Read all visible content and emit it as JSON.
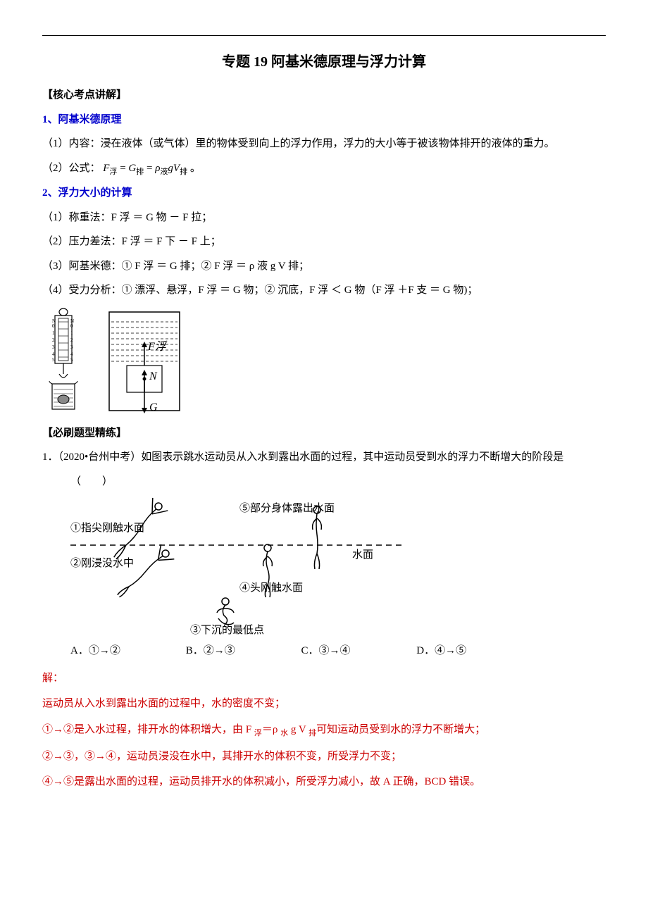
{
  "title": "专题 19 阿基米德原理与浮力计算",
  "sections": {
    "core_label": "【核心考点讲解】",
    "h1": "1、阿基米德原理",
    "p1": "（1）内容：浸在液体（或气体）里的物体受到向上的浮力作用，浮力的大小等于被该物体排开的液体的重力。",
    "p2_prefix": "（2）公式：",
    "formula": {
      "F": "F",
      "浮": "浮",
      "eq": " = ",
      "G": "G",
      "排": "排",
      "rho": "ρ",
      "液": "液",
      "g": "g",
      "V": "V",
      "period": "。"
    },
    "h2": "2、浮力大小的计算",
    "m1": "（1）称重法：F 浮 ＝ G 物 － F 拉；",
    "m2": "（2）压力差法：F 浮 ＝ F 下 － F 上；",
    "m3": "（3）阿基米德：① F 浮 ＝ G 排；② F 浮 ＝ ρ 液 g  V 排；",
    "m4": "（4）受力分析：① 漂浮、悬浮，F 浮 ＝ G 物；② 沉底，F 浮 ＜ G 物（F 浮 ＋F 支 ＝ G 物)；",
    "diag_labels": {
      "Ff": "F浮",
      "N": "N",
      "G": "G"
    },
    "practice_label": "【必刷题型精练】",
    "q1_stem_a": "1．（2020•台州中考）如图表示跳水运动员从入水到露出水面的过程，其中运动员受到水的浮力不断增大的阶段是",
    "q1_stem_b": "（　　）",
    "q1_labels": {
      "l1": "①指尖刚触水面",
      "l2": "②刚浸没水中",
      "l3": "③下沉的最低点",
      "l4": "④头刚触水面",
      "l5": "⑤部分身体露出水面",
      "water": "水面"
    },
    "options": {
      "A": "A．①→②",
      "B": "B．②→③",
      "C": "C．③→④",
      "D": "D．④→⑤"
    },
    "solve_label": "解：",
    "s1": "运动员从入水到露出水面的过程中，水的密度不变；",
    "s2a": "①→②是入水过程，排开水的体积增大，由 F ",
    "s2_sub1": "浮",
    "s2b": "＝ρ ",
    "s2_sub2": "水",
    "s2c": " g  V ",
    "s2_sub3": "排",
    "s2d": "可知运动员受到水的浮力不断增大；",
    "s3": "②→③，③→④，运动员浸没在水中，其排开水的体积不变，所受浮力不变；",
    "s4": "④→⑤是露出水面的过程，运动员排开水的体积减小，所受浮力减小，故 A 正确，BCD 错误。"
  }
}
